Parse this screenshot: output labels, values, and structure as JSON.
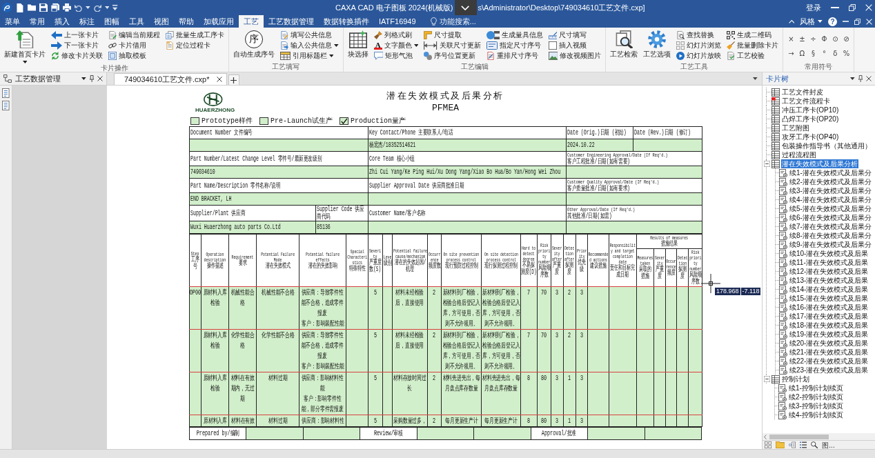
{
  "title_bar": {
    "title": "CAXA CAD 电子图板 2024(机械版)",
    "path": "s\\Administrator\\Desktop\\749034610工艺文件.cxp]",
    "login": "登录"
  },
  "menu_tabs": [
    {
      "label": "菜单",
      "selected": false
    },
    {
      "label": "常用",
      "selected": false
    },
    {
      "label": "插入",
      "selected": false
    },
    {
      "label": "标注",
      "selected": false
    },
    {
      "label": "图幅",
      "selected": false
    },
    {
      "label": "工具",
      "selected": false
    },
    {
      "label": "视图",
      "selected": false
    },
    {
      "label": "帮助",
      "selected": false
    },
    {
      "label": "加载应用",
      "selected": false
    },
    {
      "label": "工艺",
      "selected": true
    },
    {
      "label": "工艺数据管理",
      "selected": false
    },
    {
      "label": "数据转换插件",
      "selected": false
    },
    {
      "label": "IATF16949",
      "selected": false
    }
  ],
  "feature_search": {
    "placeholder": "功能搜索..."
  },
  "style_menu": {
    "label": "风格"
  },
  "help": {
    "label": "?"
  },
  "ribbon": {
    "groups": [
      {
        "title": "卡片操作",
        "large": [
          {
            "label": "新建首页卡片",
            "dropdown": true
          }
        ],
        "columns": [
          [
            {
              "label": "上一张卡片",
              "dropdown": false
            },
            {
              "label": "下一张卡片",
              "dropdown": false
            },
            {
              "label": "修改卡片关联",
              "dropdown": false
            }
          ],
          [
            {
              "label": "编辑当前规程",
              "dropdown": false
            },
            {
              "label": "卡片借用",
              "dropdown": false
            },
            {
              "label": "抽取模板",
              "dropdown": false
            }
          ],
          [
            {
              "label": "批量生成工序卡",
              "dropdown": false
            },
            {
              "label": "定位过程卡",
              "dropdown": false
            }
          ]
        ]
      },
      {
        "title": "工艺填写",
        "large": [
          {
            "label": "自动生成序号",
            "icon_text": "序",
            "dropdown": false
          }
        ],
        "columns": [
          [
            {
              "label": "填写公共信息",
              "dropdown": false
            },
            {
              "label": "输入公共信息",
              "dropdown": true
            },
            {
              "label": "引用标题栏",
              "dropdown": true
            }
          ]
        ]
      },
      {
        "title": "工艺编辑",
        "large": [
          {
            "label": "块选择",
            "dropdown": false
          }
        ],
        "columns": [
          [
            {
              "label": "列格式刷",
              "dropdown": false
            },
            {
              "label": "文字颜色",
              "icon_text": "A",
              "dropdown": true
            },
            {
              "label": "矩形气泡",
              "dropdown": false
            }
          ],
          [
            {
              "label": "尺寸提取",
              "dropdown": false
            },
            {
              "label": "关联尺寸更新",
              "dropdown": false
            },
            {
              "label": "序号位置更新",
              "dropdown": false
            }
          ],
          [
            {
              "label": "生成量具信息",
              "dropdown": false
            },
            {
              "label": "指定尺寸序号",
              "dropdown": false
            },
            {
              "label": "重排尺寸序号",
              "dropdown": false
            }
          ],
          [
            {
              "label": "尺寸填写",
              "dropdown": false
            },
            {
              "label": "插入视频",
              "dropdown": false
            },
            {
              "label": "修改视频图片",
              "dropdown": false
            }
          ]
        ]
      },
      {
        "title": "工艺工具",
        "large": [
          {
            "label": "工艺检索",
            "dropdown": false
          },
          {
            "label": "工艺选项",
            "dropdown": false
          }
        ],
        "columns": [
          [
            {
              "label": "查找替换",
              "dropdown": false
            },
            {
              "label": "幻灯片浏览",
              "dropdown": false
            },
            {
              "label": "幻灯片放映",
              "dropdown": false
            }
          ],
          [
            {
              "label": "生成二维码",
              "dropdown": false
            },
            {
              "label": "批量删除卡片",
              "dropdown": false
            },
            {
              "label": "工艺校验",
              "dropdown": false
            }
          ]
        ]
      },
      {
        "title": "常用符号",
        "symbols": [
          [
            "×",
            "±",
            "÷",
            "Φ",
            "⊙",
            "⊘"
          ],
          [
            "→",
            "Ω",
            "§",
            "°",
            "δ",
            "%"
          ]
        ]
      }
    ]
  },
  "panels": {
    "left_title": "工艺数据管理",
    "right_title": "卡片树"
  },
  "doc_tabs": [
    {
      "label": "749034610工艺文件.cxp*",
      "selected": true
    }
  ],
  "document": {
    "logo_text": "HUAERZHONG",
    "title": "潜在失效模式及后果分析",
    "subtitle": "PFMEA",
    "production_stage": [
      {
        "label": "Prototype样件",
        "checked": false
      },
      {
        "label": "Pre-Launch试生产",
        "checked": false
      },
      {
        "label": "Production量产",
        "checked": true
      }
    ],
    "info": {
      "document_number": {
        "label": [
          "Document Number 文件编号"
        ]
      },
      "key_contact": {
        "label": [
          "Key Contact/Phone 主要联系人/电话"
        ],
        "value": "杨宏杰/18352514621"
      },
      "date_orig": {
        "label": [
          "Date (Orig.)日期 (初始)"
        ],
        "value": "2024.10.22"
      },
      "date_rev": {
        "label": [
          "Date (Rev.)日期 (修订)"
        ]
      },
      "part_number": {
        "label": [
          "Part Number/Latest Change Level 零件号/最新更改级别"
        ],
        "value": "749034610"
      },
      "core_team": {
        "label": [
          "Core Team 核心小组"
        ],
        "value": "Zhi Cui Yang/Ke Ping Hui/Xu Dong Yang/Xiao Bo Hua/Bo Yan/Hong Wei Zhou"
      },
      "customer_engineering_approval": {
        "label": [
          "Customer Engineering Approval/Date (If Req'd.)",
          "客户工程批准/日期(如有需要)"
        ]
      },
      "part_name": {
        "label": [
          "Part Name/Description 零件名称/说明"
        ],
        "value": "END BRACKET, LH"
      },
      "supplier_approval_date": {
        "label": [
          "Supplier Approval Date 供应商批准日期"
        ]
      },
      "customer_quality_approval": {
        "label": [
          "Customer Quality Approval/Date (If Req'd.)",
          "客户质量批准/日期(如有要求)"
        ]
      },
      "supplier_plant": {
        "label": [
          "Supplier/Plant 供应商"
        ],
        "value": "Wuxi Huaerzhong auto parts Co.Ltd"
      },
      "supplier_code": {
        "label": [
          "Supplier Code 供应商代码"
        ],
        "value": "85136"
      },
      "customer_name": {
        "label": [
          "Customer Name/客户名称"
        ]
      },
      "other_approval": {
        "label": [
          "Other Approval/Date (If Req'd.)",
          "其他批准/日期(如需)"
        ]
      }
    },
    "columns": [
      {
        "en": "Step",
        "zh": "工序号"
      },
      {
        "en": "Operation description",
        "zh": "操作描述"
      },
      {
        "en": "Requirement",
        "zh": "要求"
      },
      {
        "en": "Potential Failure Mode",
        "zh": "潜在失效模式"
      },
      {
        "en": "Potential failure effects",
        "zh": "潜在的失效影响"
      },
      {
        "en": "Special Characteristics",
        "zh": "特殊特性"
      },
      {
        "en": "Severity",
        "zh": "严重度数(S)"
      },
      {
        "en": "Leve",
        "zh": "级别"
      },
      {
        "en": "Potential failure cause/mechanism",
        "zh": "潜在的失效起因/机理"
      },
      {
        "en": "Occurrence",
        "zh": "频度数"
      },
      {
        "en": "On site prevention process control",
        "zh": "现行预防过程控制"
      },
      {
        "en": "On site detection process control",
        "zh": "现行探测过程控制"
      },
      {
        "en": "Hard to detect degree",
        "zh": "不易探测度(D)"
      },
      {
        "en": "Risk priority number",
        "zh": "风险顺序数"
      },
      {
        "en": "Severity after",
        "zh": "严重度"
      },
      {
        "en": "Detection after",
        "zh": "探测度"
      },
      {
        "en": "Priority",
        "zh": "优先级"
      },
      {
        "en": "Recommended actions",
        "zh": "建议措施"
      },
      {
        "en": "Responsibility and target completion date",
        "zh": "责任和目标完成日期"
      },
      {
        "en": "Results of measures",
        "zh": "措施结果",
        "children": [
          {
            "en": "Measures taken",
            "zh": "采取的措施"
          },
          {
            "en": "Severity",
            "zh": "严重度"
          },
          {
            "en": "Occurrence",
            "zh": "频度"
          },
          {
            "en": "Detection",
            "zh": "探测度"
          },
          {
            "en": "Risk priority number",
            "zh": "风险顺序数"
          }
        ]
      }
    ],
    "rows": [
      {
        "step": "OP00",
        "operation": "原材料入库检验",
        "requirement": "机械性能合格",
        "failure_mode": "机械性能不合格",
        "failure_effects": [
          "供应商：导致零件性能不合格，造成零件报废",
          "客户：影响装配性能"
        ],
        "severity": "5",
        "failure_cause": "材料未经检验后，直接使用",
        "occurrence": "2",
        "prevention_control": "新材料到厂检验，检验合格后登记入库，方可使用，否则不允许领用。",
        "detection_control": "新材料到厂检验，检验合格后登记入库，方可使用，否则不允许领用。",
        "detection": "7",
        "rpn": "70",
        "severity_after": "3",
        "detection_after": "2",
        "priority": "3"
      },
      {
        "operation": "原材料入库检验",
        "requirement": "化学性能合格",
        "failure_mode": "化学性能不合格",
        "failure_effects": [
          "供应商：导致零件性能不合格，造成零件报废",
          "客户：影响装配性能"
        ],
        "severity": "5",
        "failure_cause": "材料未经检验后，直接使用",
        "occurrence": "2",
        "prevention_control": "新材料到厂检验，检验合格后登记入库，方可使用，否则不允许领用。",
        "detection_control": "新材料到厂检验，检验合格后登记入库，方可使用，否则不允许领用。",
        "detection": "7",
        "rpn": "70",
        "severity_after": "3",
        "detection_after": "2",
        "priority": "3"
      },
      {
        "operation": "原材料入库检验",
        "requirement": "材料在有效期内，无过期",
        "failure_mode": "材料过期",
        "failure_effects": [
          "供应商：影响材料性能",
          "客户：影响零件性能，部分零件需报废"
        ],
        "severity": "5",
        "failure_cause": "材料存放时间过长",
        "occurrence": "2",
        "prevention_control": "材料先进先出，每月盘点库存数量",
        "detection_control": "材料先进先出，每月盘点库存数量",
        "detection": "8",
        "rpn": "80",
        "severity_after": "3",
        "detection_after": "1",
        "priority": "3"
      },
      {
        "operation": "原材料入库",
        "requirement": "材料在有效",
        "failure_mode": "材料过期",
        "failure_effects": [
          "供应商：影响材料性"
        ],
        "severity": "5",
        "failure_cause": "采购数量过多，",
        "occurrence": "2",
        "prevention_control": "每月更新生产计",
        "detection_control": "每月更新生产计",
        "detection": "8",
        "rpn": "80",
        "severity_after": "3",
        "detection_after": "1",
        "priority": "3"
      }
    ],
    "signoff": [
      "Prepared by/编制",
      "Review/审核",
      "Approval/批准"
    ]
  },
  "canvas": {
    "cursor_coords": [
      "178.968",
      "-7.118"
    ]
  },
  "card_tree": {
    "items": [
      {
        "label": "工艺文件封皮",
        "selected": false
      },
      {
        "label": "工艺文件流程卡",
        "selected": false
      },
      {
        "label": "冲压工序卡(OP10)",
        "selected": false
      },
      {
        "label": "凸焊工序卡(OP20)",
        "selected": false
      },
      {
        "label": "工艺附图",
        "selected": false
      },
      {
        "label": "攻牙工序卡(OP40)",
        "selected": false
      },
      {
        "label": "包装操作指导书（其他通用）",
        "selected": false
      },
      {
        "label": "过程流程图",
        "selected": false
      },
      {
        "label": "潜在失效模式及后果分析",
        "selected": true,
        "expanded": true,
        "children": [
          {
            "label": "续1-潜在失效模式及后果分",
            "selected": false
          },
          {
            "label": "续2-潜在失效模式及后果分",
            "selected": false
          },
          {
            "label": "续3-潜在失效模式及后果分",
            "selected": false
          },
          {
            "label": "续4-潜在失效模式及后果分",
            "selected": false
          },
          {
            "label": "续5-潜在失效模式及后果分",
            "selected": false
          },
          {
            "label": "续6-潜在失效模式及后果分",
            "selected": false
          },
          {
            "label": "续7-潜在失效模式及后果分",
            "selected": false
          },
          {
            "label": "续8-潜在失效模式及后果分",
            "selected": false
          },
          {
            "label": "续9-潜在失效模式及后果分",
            "selected": false
          },
          {
            "label": "续10-潜在失效模式及后果",
            "selected": false
          },
          {
            "label": "续11-潜在失效模式及后果",
            "selected": false
          },
          {
            "label": "续12-潜在失效模式及后果",
            "selected": false
          },
          {
            "label": "续13-潜在失效模式及后果",
            "selected": false
          },
          {
            "label": "续14-潜在失效模式及后果",
            "selected": false
          },
          {
            "label": "续15-潜在失效模式及后果",
            "selected": false
          },
          {
            "label": "续16-潜在失效模式及后果",
            "selected": false
          },
          {
            "label": "续17-潜在失效模式及后果",
            "selected": false
          },
          {
            "label": "续18-潜在失效模式及后果",
            "selected": false
          },
          {
            "label": "续19-潜在失效模式及后果",
            "selected": false
          },
          {
            "label": "续20-潜在失效模式及后果",
            "selected": false
          },
          {
            "label": "续21-潜在失效模式及后果",
            "selected": false
          },
          {
            "label": "续22-潜在失效模式及后果",
            "selected": false
          },
          {
            "label": "续23-潜在失效模式及后果",
            "selected": false
          }
        ]
      },
      {
        "label": "控制计划",
        "selected": false,
        "expanded": true,
        "children": [
          {
            "label": "续1-控制计划续页",
            "selected": false
          },
          {
            "label": "续2-控制计划续页",
            "selected": false
          },
          {
            "label": "续3-控制计划续页",
            "selected": false
          },
          {
            "label": "续4-控制计划续页",
            "selected": false
          }
        ]
      }
    ]
  },
  "tree_tabs": {
    "label": "图..."
  }
}
